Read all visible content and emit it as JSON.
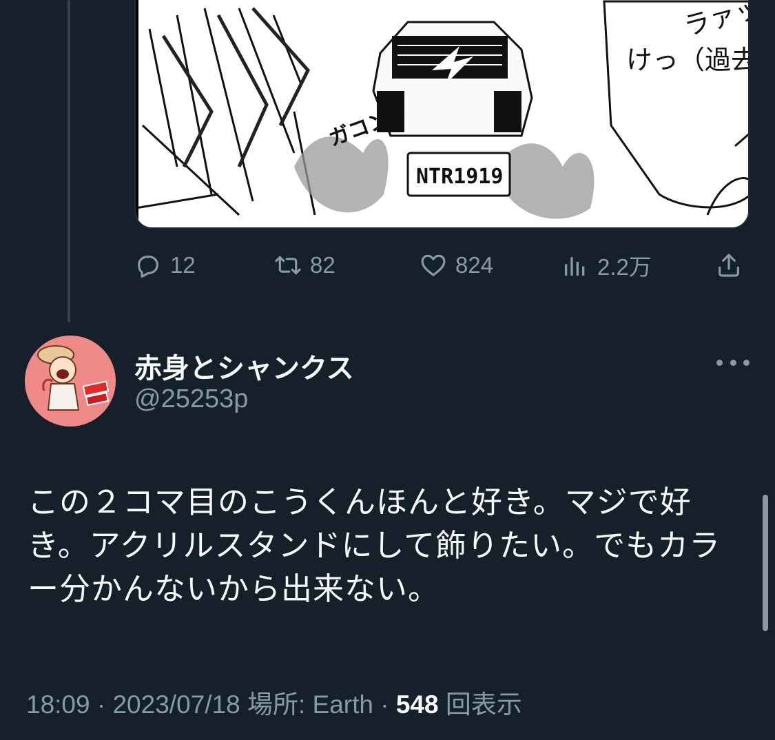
{
  "media": {
    "sfx_text": "ガコンッ",
    "bubble_text_1": "ラァッ！",
    "bubble_text_2": "けっ（過去へ）",
    "plate_text": "NTR1919"
  },
  "actions": {
    "reply_count": "12",
    "retweet_count": "82",
    "like_count": "824",
    "views_count": "2.2万"
  },
  "author": {
    "display_name": "赤身とシャンクス",
    "handle": "@25253p"
  },
  "tweet": {
    "line1": "この２コマ目のこうくんほんと好き。マジで好",
    "line2": "き。アクリルスタンドにして飾りたい。でもカラ",
    "line3": "ー分かんないから出来ない。"
  },
  "meta": {
    "time": "18:09",
    "date": "2023/07/18",
    "location_label": "場所: Earth",
    "views_value": "548",
    "views_label": "回表示"
  },
  "icons": [
    "reply-icon",
    "retweet-icon",
    "like-icon",
    "views-icon",
    "share-icon",
    "more-icon"
  ],
  "colors": {
    "background": "#15202b",
    "secondary_text": "#8b98a5",
    "primary_text": "#f7f9f9",
    "avatar_bg": "#ef8a88"
  }
}
